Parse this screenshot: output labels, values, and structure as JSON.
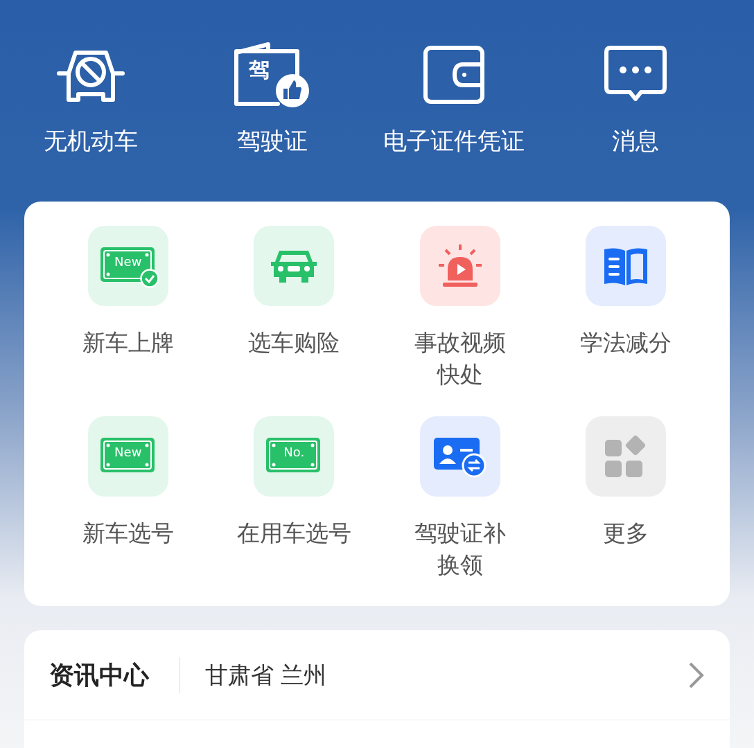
{
  "quick_links": [
    {
      "kind": "car-ban",
      "label": "无机动车"
    },
    {
      "kind": "license",
      "label": "驾驶证",
      "icon_text": "驾"
    },
    {
      "kind": "wallet",
      "label": "电子证件凭证"
    },
    {
      "kind": "chat",
      "label": "消息"
    }
  ],
  "services": [
    {
      "kind": "plate-check",
      "label": "新车上牌",
      "icon_text": "New"
    },
    {
      "kind": "car",
      "label": "选车购险"
    },
    {
      "kind": "siren",
      "label": "事故视频快处"
    },
    {
      "kind": "book",
      "label": "学法减分"
    },
    {
      "kind": "plate",
      "label": "新车选号",
      "icon_text": "New"
    },
    {
      "kind": "plate",
      "label": "在用车选号",
      "icon_text": "No."
    },
    {
      "kind": "id-swap",
      "label": "驾驶证补换领"
    },
    {
      "kind": "more",
      "label": "更多"
    }
  ],
  "news": {
    "title": "资讯中心",
    "location": "甘肃省 兰州"
  }
}
